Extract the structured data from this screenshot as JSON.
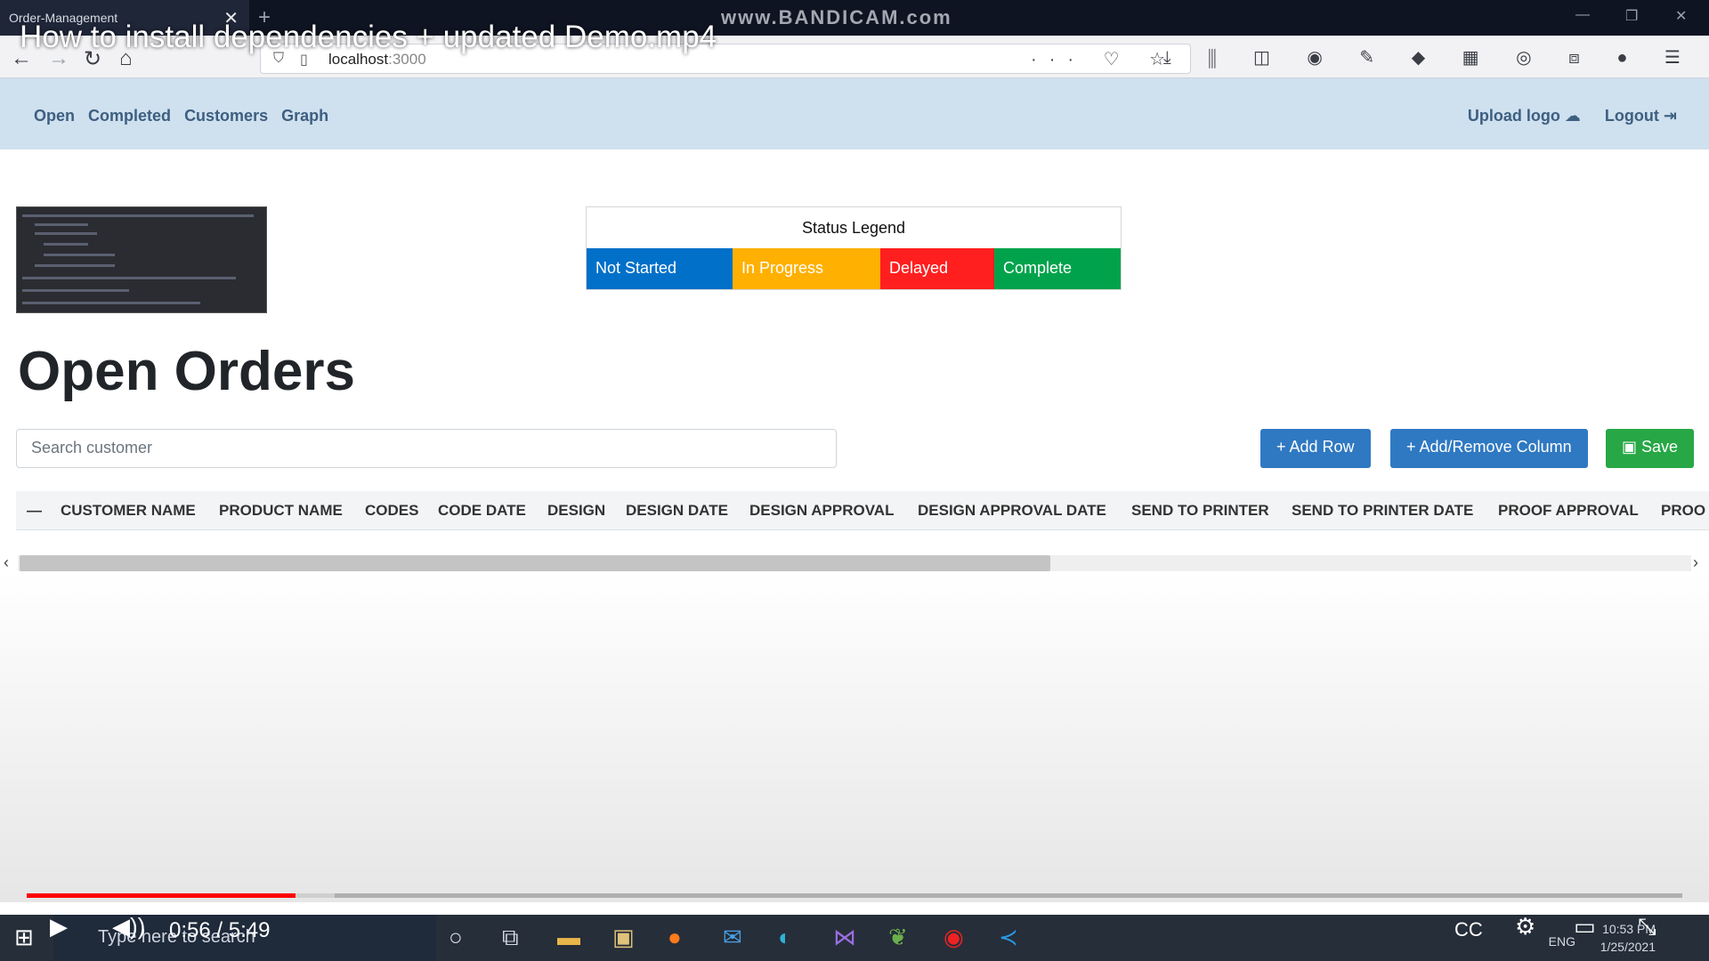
{
  "browser": {
    "tab_title": "Order-Management",
    "tab_close": "✕",
    "new_tab": "+",
    "watermark": "www.BANDICAM.com",
    "url_host": "localhost",
    "url_port": ":3000",
    "address_tools": "··· ♡ ☆"
  },
  "video": {
    "title": "How to install dependencies + updated Demo.mp4",
    "time": "0:56 / 5:49",
    "played_fraction": 0.1624,
    "buffered_fraction": 0.186
  },
  "nav": {
    "links": [
      "Open",
      "Completed",
      "Customers",
      "Graph"
    ],
    "upload_logo": "Upload logo",
    "logout": "Logout"
  },
  "legend": {
    "title": "Status Legend",
    "items": [
      {
        "label": "Not Started",
        "color": "#0070c9"
      },
      {
        "label": "In Progress",
        "color": "#ffb000"
      },
      {
        "label": "Delayed",
        "color": "#ff1f1f"
      },
      {
        "label": "Complete",
        "color": "#00a34c"
      }
    ]
  },
  "page": {
    "title": "Open Orders",
    "search_placeholder": "Search customer",
    "add_row": "+ Add Row",
    "add_remove_column": "+ Add/Remove Column",
    "save": "Save"
  },
  "table": {
    "collapse": "—",
    "columns": [
      "CUSTOMER NAME",
      "PRODUCT NAME",
      "CODES",
      "CODE DATE",
      "DESIGN",
      "DESIGN DATE",
      "DESIGN APPROVAL",
      "DESIGN APPROVAL DATE",
      "SEND TO PRINTER",
      "SEND TO PRINTER DATE",
      "PROOF APPROVAL",
      "PROO"
    ]
  },
  "taskbar": {
    "search_placeholder": "Type here to search",
    "lang": "ENG",
    "clock_time": "10:53 PM",
    "clock_date": "1/25/2021"
  },
  "colors": {
    "navbar_bg": "#cfe0ef",
    "nav_link": "#3d5f80",
    "primary_button": "#2f79c2",
    "save_button": "#27a745"
  }
}
